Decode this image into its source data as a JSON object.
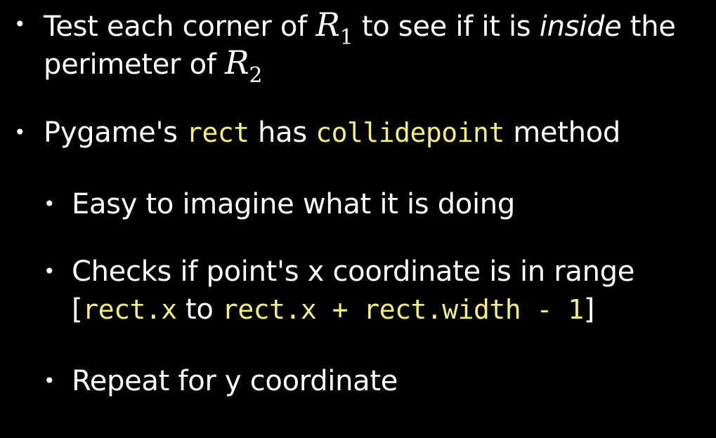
{
  "bullets": [
    {
      "line1": {
        "text_a": "Test each corner of ",
        "math_var": "R",
        "math_sub": "1",
        "text_b": " to see if it is ",
        "emph": "inside",
        "text_c": " the"
      },
      "line2": {
        "text_a": "perimeter of ",
        "math_var": "R",
        "math_sub": "2"
      }
    },
    {
      "text_a": "Pygame's ",
      "code_a": "rect",
      "text_b": " has ",
      "code_b": "collidepoint",
      "text_c": " method",
      "sub_bullets": [
        {
          "text": "Easy to imagine what it is doing"
        },
        {
          "line1": "Checks if point's x coordinate is in range",
          "line2": {
            "open": "[",
            "code_a": "rect.x",
            "mid": " to ",
            "code_b": "rect.x + rect.width - 1",
            "close": "]"
          }
        },
        {
          "text": "Repeat for y coordinate"
        }
      ]
    }
  ],
  "colors": {
    "background": "#000000",
    "text": "#ffffff",
    "code": "#f5f075"
  },
  "bullet_glyph": "•"
}
